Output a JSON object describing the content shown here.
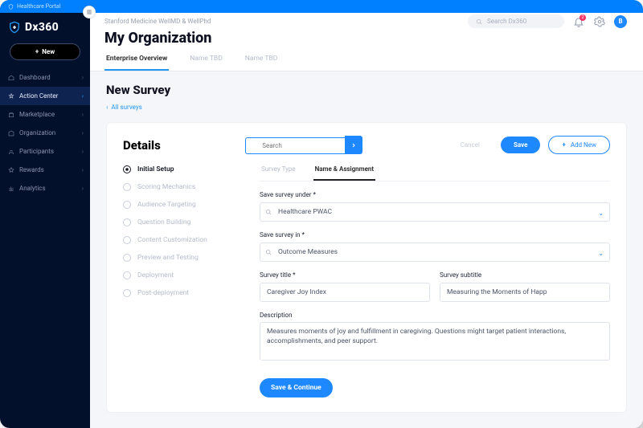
{
  "portal_banner": "Healthcare Portal",
  "brand": "Dx360",
  "new_button": "New",
  "nav": [
    {
      "label": "Dashboard"
    },
    {
      "label": "Action Center"
    },
    {
      "label": "Marketplace"
    },
    {
      "label": "Organization"
    },
    {
      "label": "Participants"
    },
    {
      "label": "Rewards"
    },
    {
      "label": "Analytics"
    }
  ],
  "nav_active_index": 1,
  "breadcrumb": "Stanford Medicine WellMD & WellPhd",
  "page_title": "My Organization",
  "global_search_placeholder": "Search Dx360",
  "notification_count": "2",
  "avatar_initial": "B",
  "tabs": [
    {
      "label": "Enterprise Overview"
    },
    {
      "label": "Name TBD"
    },
    {
      "label": "Name TBD"
    }
  ],
  "tab_active_index": 0,
  "section_title": "New Survey",
  "back_link": "All surveys",
  "card": {
    "title": "Details",
    "search_placeholder": "Search",
    "cancel": "Cancel",
    "save": "Save",
    "add_new": "Add New"
  },
  "steps": [
    "Initial Setup",
    "Scoring Mechanics",
    "Audience Targeting",
    "Question Building",
    "Content Customization",
    "Preview and Testing",
    "Deployment",
    "Post-deployment"
  ],
  "step_active_index": 0,
  "inner_tabs": [
    "Survey Type",
    "Name & Assignment"
  ],
  "inner_tab_active_index": 1,
  "form": {
    "save_under_label": "Save survey under *",
    "save_under_value": "Healthcare PWAC",
    "save_in_label": "Save survey in *",
    "save_in_value": "Outcome Measures",
    "title_label": "Survey title *",
    "title_value": "Caregiver Joy Index",
    "subtitle_label": "Survey subtitle",
    "subtitle_value": "Measuring the Moments of Happ",
    "description_label": "Description",
    "description_value": "Measures moments of joy and fulfillment in caregiving. Questions might target patient interactions, accomplishments, and peer support.",
    "save_continue": "Save & Continue"
  }
}
